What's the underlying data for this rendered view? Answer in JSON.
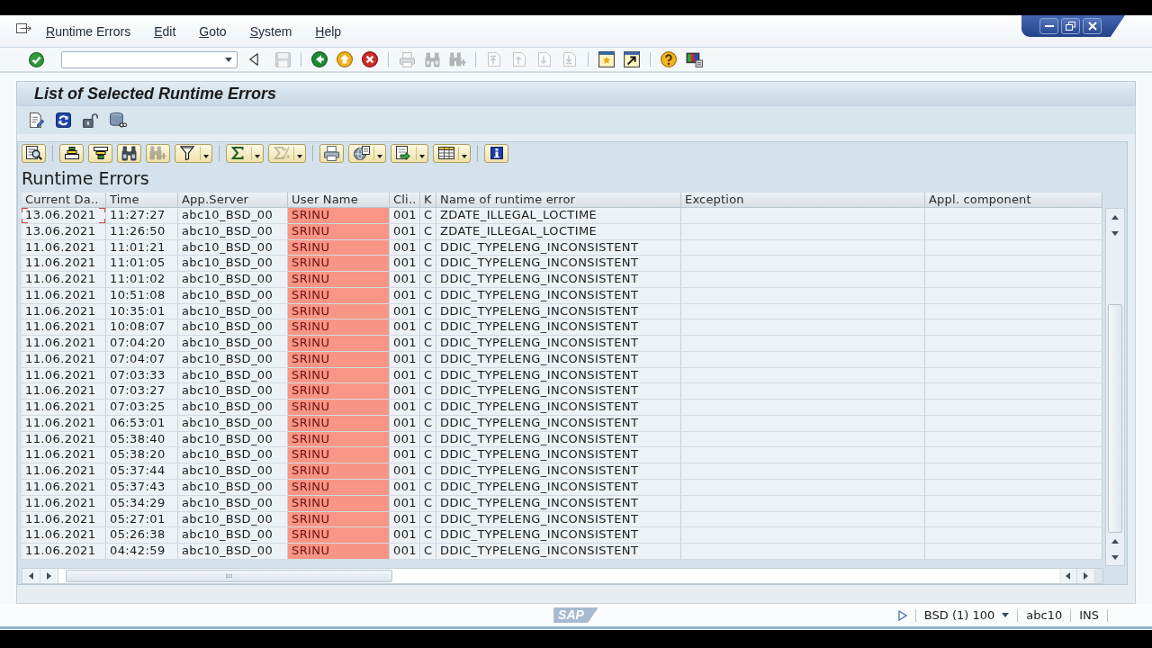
{
  "menu": [
    "Runtime Errors",
    "Edit",
    "Goto",
    "System",
    "Help"
  ],
  "toolbar": {
    "groups": [
      {
        "buttons": [
          {
            "disabled": false
          }
        ]
      },
      {
        "buttons": [
          {
            "disabled": false
          },
          {
            "disabled": true
          }
        ]
      },
      {
        "buttons": [
          {
            "disabled": false
          },
          {
            "disabled": false
          },
          {
            "disabled": false
          }
        ]
      },
      {
        "buttons": [
          {
            "disabled": true
          },
          {
            "disabled": true
          },
          {
            "disabled": true
          }
        ]
      },
      {
        "buttons": [
          {
            "disabled": true
          },
          {
            "disabled": true
          },
          {
            "disabled": true
          },
          {
            "disabled": true
          }
        ]
      },
      {
        "buttons": [
          {
            "disabled": false
          },
          {
            "disabled": false
          }
        ]
      },
      {
        "buttons": [
          {
            "disabled": false
          },
          {
            "disabled": false
          }
        ]
      }
    ]
  },
  "title": "List of Selected Runtime Errors",
  "alv_toolbar": {
    "groups": [
      {
        "buttons": [
          {
            "kind": "button",
            "disabled": false
          }
        ]
      },
      {
        "buttons": [
          {
            "kind": "button",
            "disabled": false
          },
          {
            "kind": "button",
            "disabled": false
          },
          {
            "kind": "button",
            "disabled": false
          },
          {
            "kind": "button",
            "disabled": true
          },
          {
            "kind": "menu",
            "disabled": false
          }
        ]
      },
      {
        "buttons": [
          {
            "kind": "menu",
            "disabled": false
          },
          {
            "kind": "menu",
            "disabled": true
          }
        ]
      },
      {
        "buttons": [
          {
            "kind": "button",
            "disabled": false
          },
          {
            "kind": "menu",
            "disabled": false
          },
          {
            "kind": "menu",
            "disabled": false
          },
          {
            "kind": "menu",
            "disabled": false
          }
        ]
      },
      {
        "buttons": [
          {
            "kind": "button",
            "disabled": false
          }
        ]
      }
    ]
  },
  "table": {
    "title": "Runtime Errors",
    "columns": [
      {
        "label": "Current Da.."
      },
      {
        "label": "Time"
      },
      {
        "label": "App.Server"
      },
      {
        "label": "User Name",
        "color": "#f99585"
      },
      {
        "label": "Cli.."
      },
      {
        "label": "K"
      },
      {
        "label": "Name of runtime error"
      },
      {
        "label": "Exception"
      },
      {
        "label": "Appl. component"
      }
    ],
    "rows": [
      {
        "cells": [
          "13.06.2021",
          "11:27:27",
          "abc10_BSD_00",
          "SRINU",
          "001",
          "C",
          "ZDATE_ILLEGAL_LOCTIME"
        ],
        "focused": true
      },
      {
        "cells": [
          "13.06.2021",
          "11:26:50",
          "abc10_BSD_00",
          "SRINU",
          "001",
          "C",
          "ZDATE_ILLEGAL_LOCTIME"
        ],
        "focused": false
      },
      {
        "cells": [
          "11.06.2021",
          "11:01:21",
          "abc10_BSD_00",
          "SRINU",
          "001",
          "C",
          "DDIC_TYPELENG_INCONSISTENT"
        ],
        "focused": false
      },
      {
        "cells": [
          "11.06.2021",
          "11:01:05",
          "abc10_BSD_00",
          "SRINU",
          "001",
          "C",
          "DDIC_TYPELENG_INCONSISTENT"
        ],
        "focused": false
      },
      {
        "cells": [
          "11.06.2021",
          "11:01:02",
          "abc10_BSD_00",
          "SRINU",
          "001",
          "C",
          "DDIC_TYPELENG_INCONSISTENT"
        ],
        "focused": false
      },
      {
        "cells": [
          "11.06.2021",
          "10:51:08",
          "abc10_BSD_00",
          "SRINU",
          "001",
          "C",
          "DDIC_TYPELENG_INCONSISTENT"
        ],
        "focused": false
      },
      {
        "cells": [
          "11.06.2021",
          "10:35:01",
          "abc10_BSD_00",
          "SRINU",
          "001",
          "C",
          "DDIC_TYPELENG_INCONSISTENT"
        ],
        "focused": false
      },
      {
        "cells": [
          "11.06.2021",
          "10:08:07",
          "abc10_BSD_00",
          "SRINU",
          "001",
          "C",
          "DDIC_TYPELENG_INCONSISTENT"
        ],
        "focused": false
      },
      {
        "cells": [
          "11.06.2021",
          "07:04:20",
          "abc10_BSD_00",
          "SRINU",
          "001",
          "C",
          "DDIC_TYPELENG_INCONSISTENT"
        ],
        "focused": false
      },
      {
        "cells": [
          "11.06.2021",
          "07:04:07",
          "abc10_BSD_00",
          "SRINU",
          "001",
          "C",
          "DDIC_TYPELENG_INCONSISTENT"
        ],
        "focused": false
      },
      {
        "cells": [
          "11.06.2021",
          "07:03:33",
          "abc10_BSD_00",
          "SRINU",
          "001",
          "C",
          "DDIC_TYPELENG_INCONSISTENT"
        ],
        "focused": false
      },
      {
        "cells": [
          "11.06.2021",
          "07:03:27",
          "abc10_BSD_00",
          "SRINU",
          "001",
          "C",
          "DDIC_TYPELENG_INCONSISTENT"
        ],
        "focused": false
      },
      {
        "cells": [
          "11.06.2021",
          "07:03:25",
          "abc10_BSD_00",
          "SRINU",
          "001",
          "C",
          "DDIC_TYPELENG_INCONSISTENT"
        ],
        "focused": false
      },
      {
        "cells": [
          "11.06.2021",
          "06:53:01",
          "abc10_BSD_00",
          "SRINU",
          "001",
          "C",
          "DDIC_TYPELENG_INCONSISTENT"
        ],
        "focused": false
      },
      {
        "cells": [
          "11.06.2021",
          "05:38:40",
          "abc10_BSD_00",
          "SRINU",
          "001",
          "C",
          "DDIC_TYPELENG_INCONSISTENT"
        ],
        "focused": false
      },
      {
        "cells": [
          "11.06.2021",
          "05:38:20",
          "abc10_BSD_00",
          "SRINU",
          "001",
          "C",
          "DDIC_TYPELENG_INCONSISTENT"
        ],
        "focused": false
      },
      {
        "cells": [
          "11.06.2021",
          "05:37:44",
          "abc10_BSD_00",
          "SRINU",
          "001",
          "C",
          "DDIC_TYPELENG_INCONSISTENT"
        ],
        "focused": false
      },
      {
        "cells": [
          "11.06.2021",
          "05:37:43",
          "abc10_BSD_00",
          "SRINU",
          "001",
          "C",
          "DDIC_TYPELENG_INCONSISTENT"
        ],
        "focused": false
      },
      {
        "cells": [
          "11.06.2021",
          "05:34:29",
          "abc10_BSD_00",
          "SRINU",
          "001",
          "C",
          "DDIC_TYPELENG_INCONSISTENT"
        ],
        "focused": false
      },
      {
        "cells": [
          "11.06.2021",
          "05:27:01",
          "abc10_BSD_00",
          "SRINU",
          "001",
          "C",
          "DDIC_TYPELENG_INCONSISTENT"
        ],
        "focused": false
      },
      {
        "cells": [
          "11.06.2021",
          "05:26:38",
          "abc10_BSD_00",
          "SRINU",
          "001",
          "C",
          "DDIC_TYPELENG_INCONSISTENT"
        ],
        "focused": false
      },
      {
        "cells": [
          "11.06.2021",
          "04:42:59",
          "abc10_BSD_00",
          "SRINU",
          "001",
          "C",
          "DDIC_TYPELENG_INCONSISTENT"
        ],
        "focused": false
      }
    ]
  },
  "status_bar": {
    "logo": "SAP",
    "system": "BSD (1) 100",
    "user": "abc10",
    "mode": "INS"
  }
}
